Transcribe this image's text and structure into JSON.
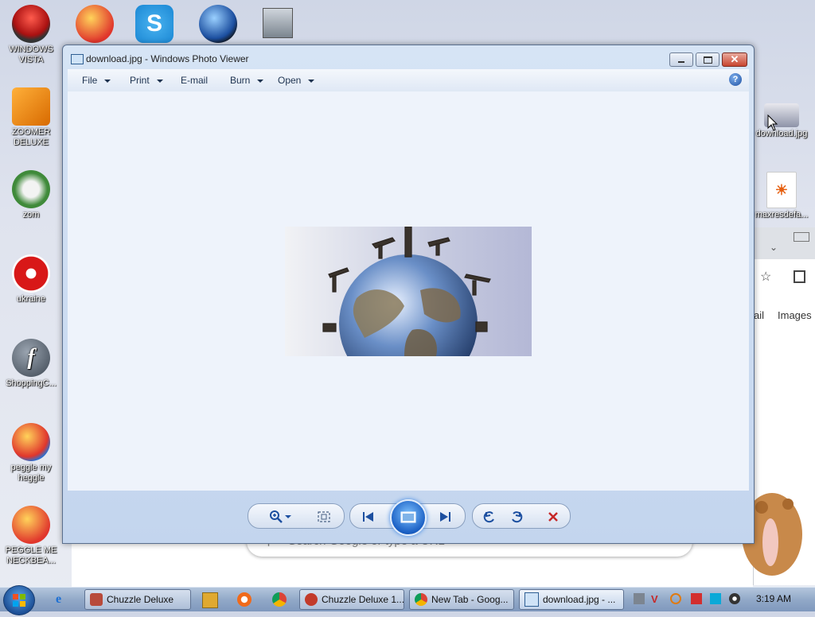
{
  "desktop": {
    "left_icons": [
      {
        "label": "WINDOWS\nVISTA"
      },
      {
        "label": "ZOOMER\nDELUXE"
      },
      {
        "label": "zom"
      },
      {
        "label": "ukraine"
      },
      {
        "label": "ShoppingC..."
      },
      {
        "label": "peggle my\nheggle"
      },
      {
        "label": "PEGGLE ME\nNECKBEA..."
      }
    ],
    "right_icons": [
      {
        "label": "download.jpg"
      },
      {
        "label": "maxresdefa..."
      }
    ],
    "bg_browser": {
      "link_mail": "ail",
      "link_images": "Images",
      "omnibox_placeholder": "Search Google or type a URL"
    }
  },
  "window": {
    "title": "download.jpg - Windows Photo Viewer",
    "menu": [
      {
        "label": "File",
        "has_dropdown": true
      },
      {
        "label": "Print",
        "has_dropdown": true
      },
      {
        "label": "E-mail",
        "has_dropdown": false
      },
      {
        "label": "Burn",
        "has_dropdown": true
      },
      {
        "label": "Open",
        "has_dropdown": true
      }
    ],
    "help_label": "?",
    "image_name": "globe-with-oil-derricks",
    "controls": [
      "zoom",
      "actual-size",
      "previous",
      "slideshow",
      "next",
      "rotate-counterclockwise",
      "rotate-clockwise",
      "delete"
    ]
  },
  "taskbar": {
    "buttons": [
      {
        "label": "Chuzzle Deluxe",
        "active": false
      },
      {
        "label": "Chuzzle Deluxe 1...",
        "active": false
      },
      {
        "label": "New Tab - Goog...",
        "active": false
      },
      {
        "label": "download.jpg - ...",
        "active": true
      }
    ],
    "clock": "3:19 AM"
  },
  "colors": {
    "accent": "#1c4fa0",
    "delete": "#c62828"
  }
}
